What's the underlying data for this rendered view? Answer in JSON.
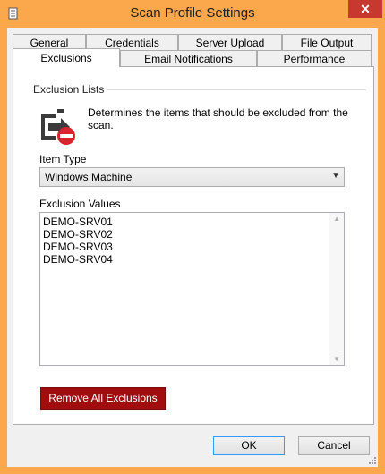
{
  "window": {
    "title": "Scan Profile Settings",
    "close_glyph": "✕"
  },
  "tabs": {
    "row_back": [
      "General",
      "Credentials",
      "Server Upload",
      "File Output"
    ],
    "row_front": [
      "Exclusions",
      "Email Notifications",
      "Performance"
    ],
    "active": "Exclusions"
  },
  "exclusions": {
    "section_label": "Exclusion Lists",
    "icon": "exclude-icon",
    "description": "Determines the items that should be excluded from the scan.",
    "item_type_label": "Item Type",
    "item_type_value": "Windows Machine",
    "values_label": "Exclusion Values",
    "values": [
      "DEMO-SRV01",
      "DEMO-SRV02",
      "DEMO-SRV03",
      "DEMO-SRV04"
    ],
    "remove_all_label": "Remove All Exclusions"
  },
  "footer": {
    "ok_label": "OK",
    "cancel_label": "Cancel"
  },
  "colors": {
    "frame": "#fba74b",
    "close": "#c7382f",
    "danger": "#a00d0f"
  }
}
